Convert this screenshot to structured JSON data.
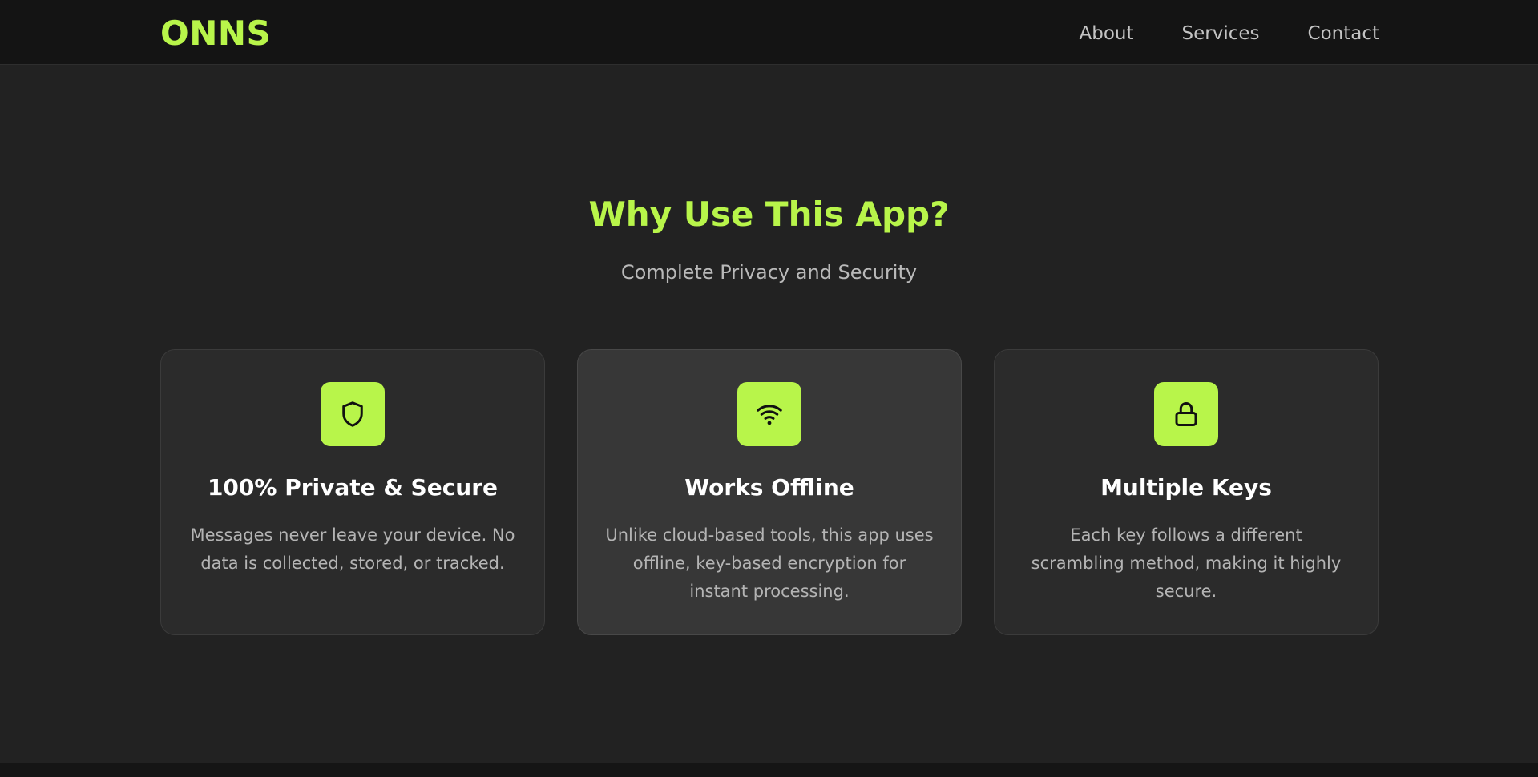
{
  "header": {
    "logo": "ONNS",
    "nav": [
      {
        "label": "About"
      },
      {
        "label": "Services"
      },
      {
        "label": "Contact"
      }
    ]
  },
  "hero": {
    "title": "Why Use This App?",
    "subtitle": "Complete Privacy and Security"
  },
  "features": [
    {
      "icon": "shield-icon",
      "title": "100% Private & Secure",
      "text": "Messages never leave your device. No data is collected, stored, or tracked."
    },
    {
      "icon": "wifi-icon",
      "title": "Works Offline",
      "text": "Unlike cloud-based tools, this app uses offline, key-based encryption for instant processing."
    },
    {
      "icon": "lock-icon",
      "title": "Multiple Keys",
      "text": "Each key follows a different scrambling method, making it highly secure."
    }
  ],
  "colors": {
    "accent": "#b8f54a",
    "background": "#222222",
    "header": "#141414",
    "card": "#2b2b2b",
    "card_highlight": "#373737"
  }
}
